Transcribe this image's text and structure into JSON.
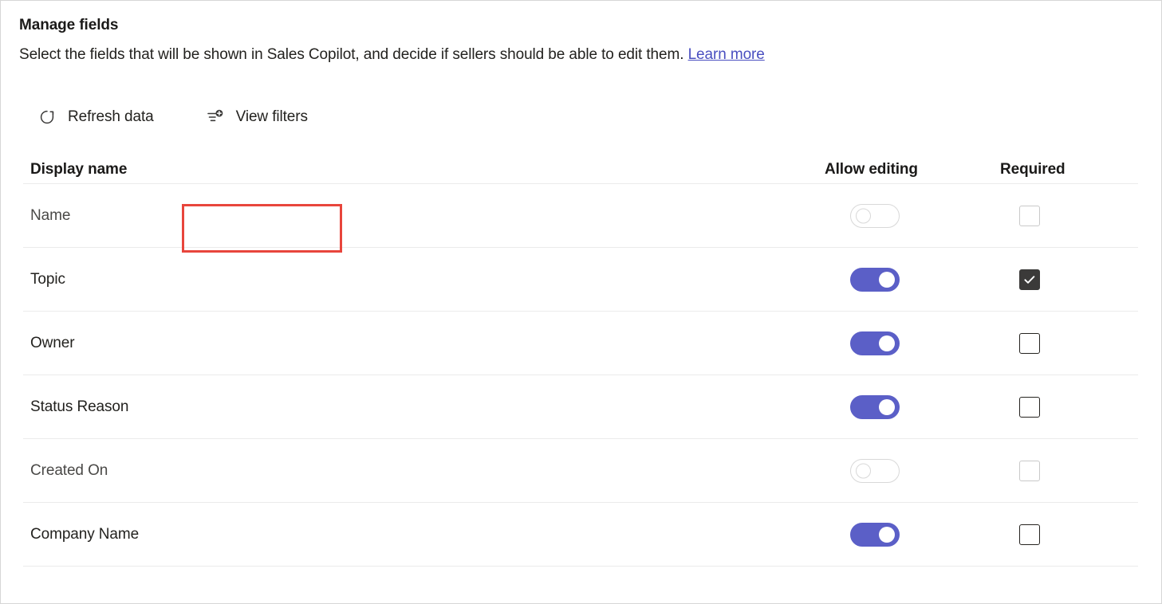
{
  "header": {
    "title": "Manage fields",
    "subtitle_text": "Select the fields that will be shown in Sales Copilot, and decide if sellers should be able to edit them.",
    "learn_more_label": "Learn more"
  },
  "toolbar": {
    "refresh_label": "Refresh data",
    "refresh_icon": "refresh-icon",
    "view_filters_label": "View filters",
    "view_filters_icon": "filter-add-icon",
    "highlight_color": "#E8453C"
  },
  "table": {
    "columns": {
      "display_name": "Display name",
      "allow_editing": "Allow editing",
      "required": "Required"
    },
    "rows": [
      {
        "display_name": "Name",
        "allow_editing": false,
        "editing_disabled": true,
        "required": false,
        "required_disabled": true
      },
      {
        "display_name": "Topic",
        "allow_editing": true,
        "editing_disabled": false,
        "required": true,
        "required_disabled": false
      },
      {
        "display_name": "Owner",
        "allow_editing": true,
        "editing_disabled": false,
        "required": false,
        "required_disabled": false
      },
      {
        "display_name": "Status Reason",
        "allow_editing": true,
        "editing_disabled": false,
        "required": false,
        "required_disabled": false
      },
      {
        "display_name": "Created On",
        "allow_editing": false,
        "editing_disabled": true,
        "required": false,
        "required_disabled": true
      },
      {
        "display_name": "Company Name",
        "allow_editing": true,
        "editing_disabled": false,
        "required": false,
        "required_disabled": false
      }
    ]
  },
  "colors": {
    "toggle_on": "#5B5FC7",
    "checkbox_checked": "#3B3A39",
    "link": "#4A4FC0",
    "divider": "#EBEBEB"
  }
}
